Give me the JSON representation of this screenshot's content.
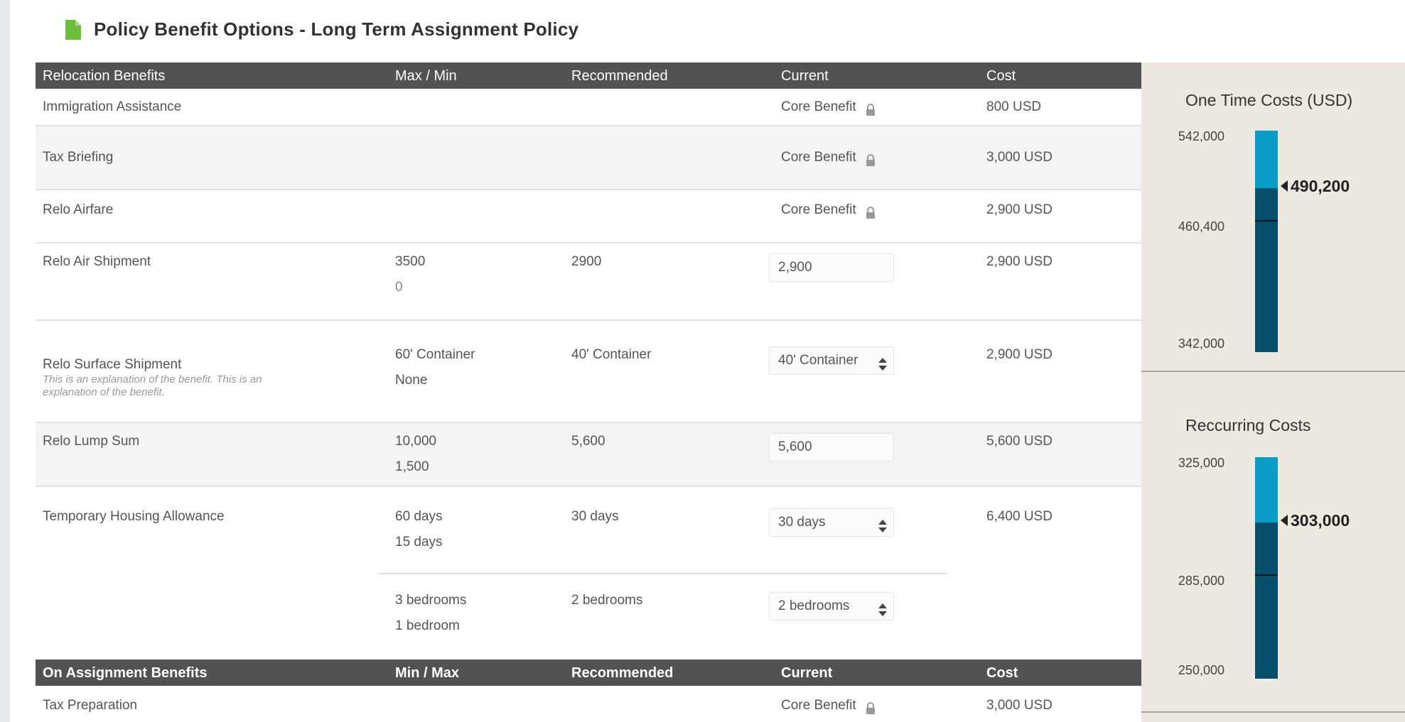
{
  "page": {
    "title": "Policy Benefit Options - Long Term Assignment Policy",
    "icon": "document-icon",
    "accent_color": "#6bbf3b"
  },
  "relocation_header": [
    "Relocation Benefits",
    "Max / Min",
    "Recommended",
    "Current",
    "Cost"
  ],
  "relocation_rows": [
    {
      "name": "Immigration Assistance",
      "current": "Core Benefit",
      "locked": true,
      "cost": "800 USD"
    },
    {
      "name": "Tax Briefing",
      "current": "Core Benefit",
      "locked": true,
      "cost": "3,000 USD"
    },
    {
      "name": "Relo Airfare",
      "current": "Core Benefit",
      "locked": true,
      "cost": "2,900 USD"
    },
    {
      "name": "Relo Air Shipment",
      "max": "3500",
      "min": "0",
      "recommended": "2900",
      "current_value": "2,900",
      "cost": "2,900 USD"
    },
    {
      "name": "Relo Surface Shipment",
      "explanation": "This is an explanation of the benefit. This is an explanation of the benefit.",
      "max": "60' Container",
      "min": "None",
      "recommended": "40' Container",
      "current_value": "40' Container",
      "cost": "2,900 USD"
    },
    {
      "name": "Relo Lump Sum",
      "max": "10,000",
      "min": "1,500",
      "recommended": "5,600",
      "current_value": "5,600",
      "cost": "5,600 USD"
    },
    {
      "name": "Temporary Housing Allowance",
      "max": "60 days",
      "min": "15 days",
      "recommended": "30 days",
      "current_value": "30 days",
      "cost": "6,400 USD",
      "max2": "3 bedrooms",
      "min2": "1 bedroom",
      "recommended2": "2 bedrooms",
      "current_value2": "2 bedrooms"
    }
  ],
  "assignment_header": [
    "On Assignment Benefits",
    "Min / Max",
    "Recommended",
    "Current",
    "Cost"
  ],
  "assignment_rows": [
    {
      "name": "Tax Preparation",
      "current": "Core Benefit",
      "locked": true,
      "cost": "3,000 USD"
    }
  ],
  "one_time": {
    "title": "One Time Costs (USD)",
    "max_label": "542,000",
    "mid_label": "460,400",
    "min_label": "342,000",
    "max": 542000,
    "mid": 460400,
    "min": 342000,
    "value": 490200,
    "value_label": "490,200",
    "light_color": "#0a9cc9",
    "dark_color": "#064f6b"
  },
  "recurring": {
    "title": "Reccurring Costs",
    "max_label": "325,000",
    "mid_label": "285,000",
    "min_label": "250,000",
    "max": 325000,
    "mid": 285000,
    "min": 250000,
    "value": 303000,
    "value_label": "303,000",
    "light_color": "#0a9cc9",
    "dark_color": "#064f6b"
  }
}
